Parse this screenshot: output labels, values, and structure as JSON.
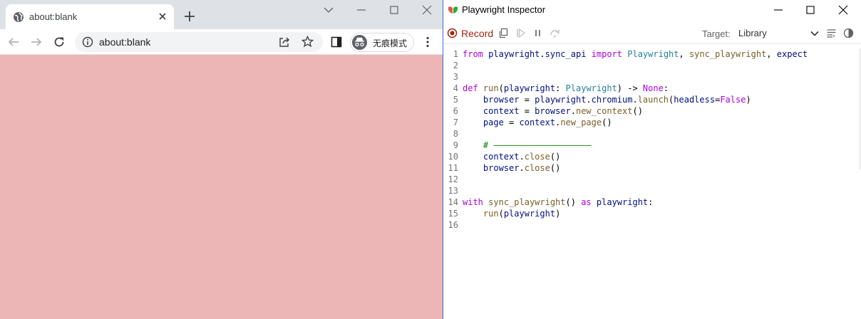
{
  "browser": {
    "tab_title": "about:blank",
    "url": "about:blank",
    "incognito_label": "无痕模式",
    "page_bg": "#ecb6b6",
    "icons": [
      "globe-icon",
      "close-icon",
      "plus-icon",
      "chevron-down-icon",
      "minimize-icon",
      "maximize-icon",
      "back-icon",
      "forward-icon",
      "reload-icon",
      "info-icon",
      "share-icon",
      "star-icon",
      "sidepanel-icon",
      "incognito-icon",
      "kebab-menu-icon"
    ]
  },
  "inspector": {
    "title": "Playwright Inspector",
    "record_label": "Record",
    "target_label": "Target:",
    "target_value": "Library",
    "record_color": "#a1260d",
    "code_lines": [
      {
        "n": "1",
        "text": "from playwright.sync_api import Playwright, sync_playwright, expect"
      },
      {
        "n": "2",
        "text": ""
      },
      {
        "n": "3",
        "text": ""
      },
      {
        "n": "4",
        "text": "def run(playwright: Playwright) -> None:"
      },
      {
        "n": "5",
        "text": "    browser = playwright.chromium.launch(headless=False)"
      },
      {
        "n": "6",
        "text": "    context = browser.new_context()"
      },
      {
        "n": "7",
        "text": "    page = context.new_page()"
      },
      {
        "n": "8",
        "text": ""
      },
      {
        "n": "9",
        "text": "    # ———————————————————"
      },
      {
        "n": "10",
        "text": "    context.close()"
      },
      {
        "n": "11",
        "text": "    browser.close()"
      },
      {
        "n": "12",
        "text": ""
      },
      {
        "n": "13",
        "text": ""
      },
      {
        "n": "14",
        "text": "with sync_playwright() as playwright:"
      },
      {
        "n": "15",
        "text": "    run(playwright)"
      },
      {
        "n": "16",
        "text": ""
      }
    ]
  }
}
